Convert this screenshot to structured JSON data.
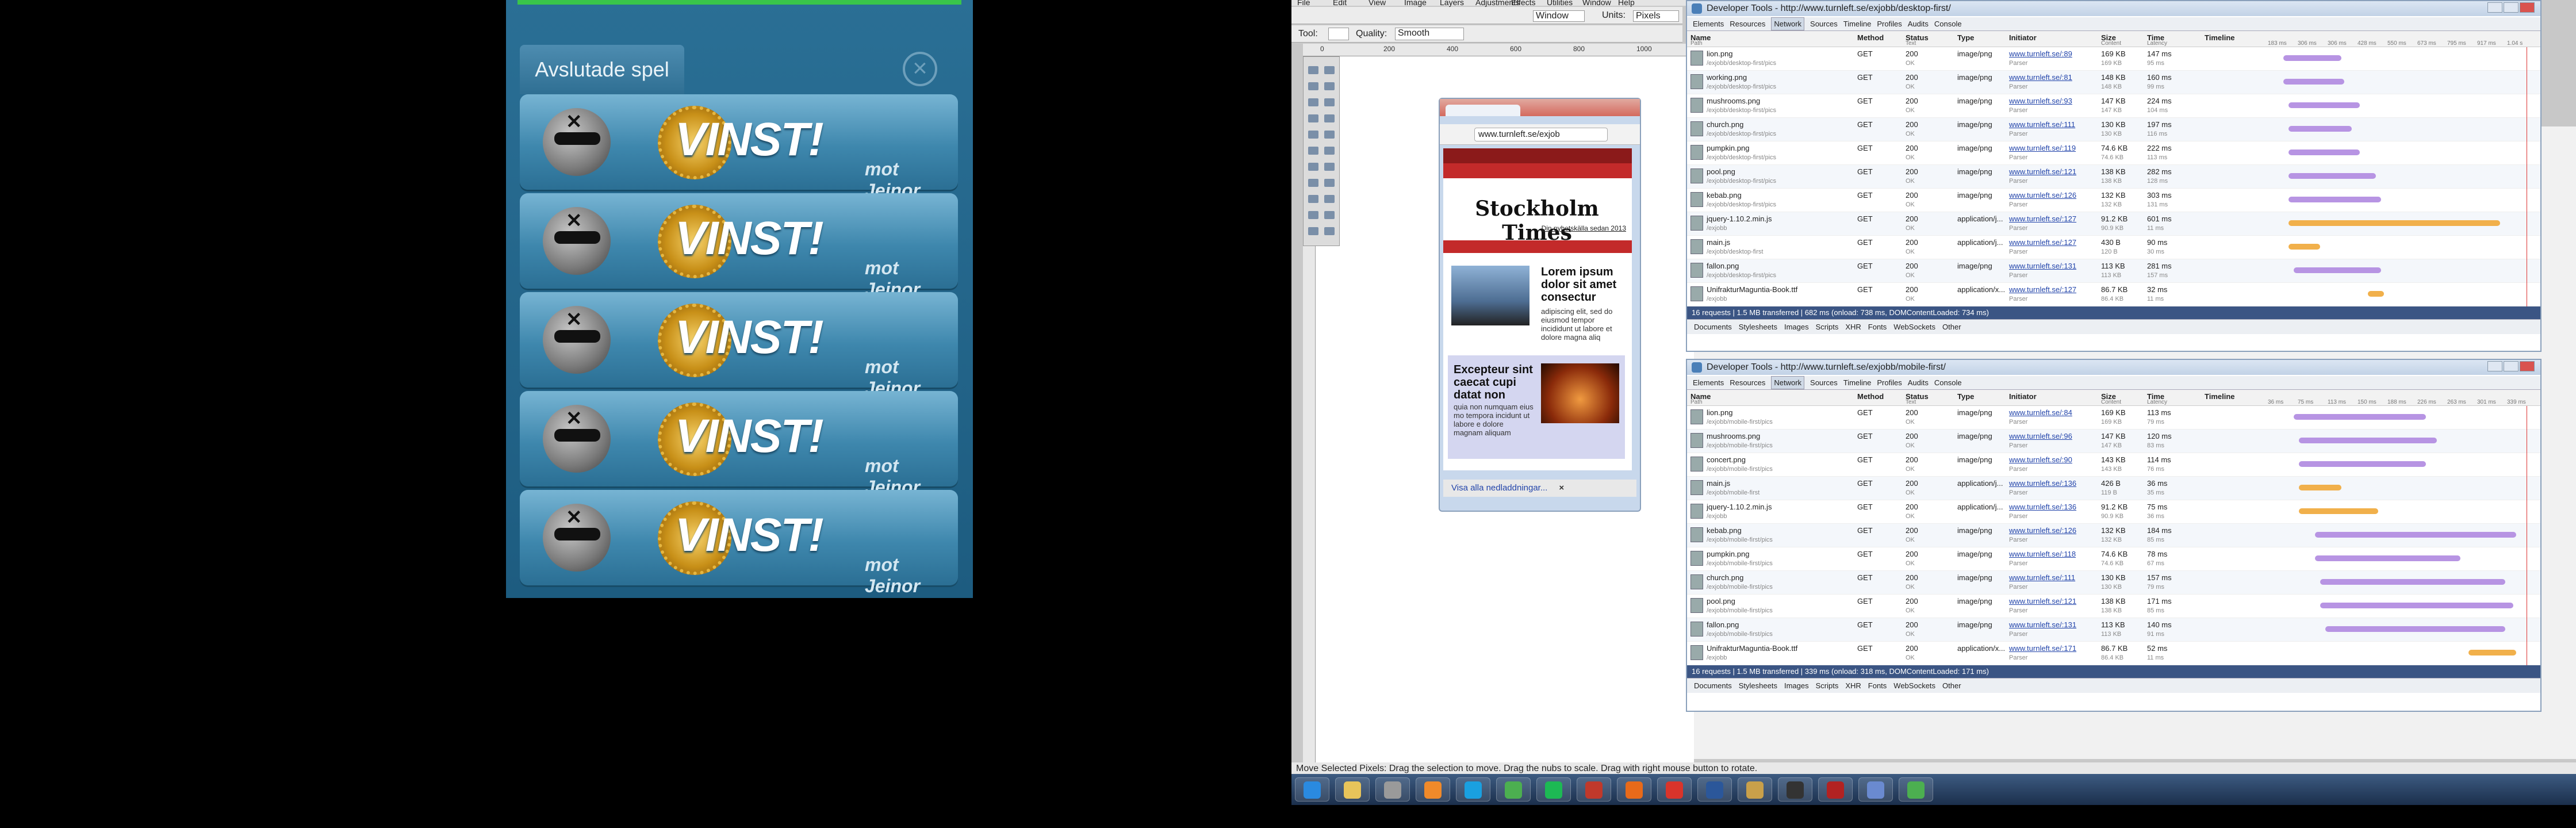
{
  "game": {
    "header": "Avslutade spel",
    "rows": [
      {
        "result": "VINST!",
        "opponent": "mot Jeinor"
      },
      {
        "result": "VINST!",
        "opponent": "mot Jeinor"
      },
      {
        "result": "VINST!",
        "opponent": "mot Jeinor"
      },
      {
        "result": "VINST!",
        "opponent": "mot Jeinor"
      },
      {
        "result": "VINST!",
        "opponent": "mot Jeinor"
      }
    ]
  },
  "photoshop": {
    "menu": [
      "File",
      "Edit",
      "View",
      "Image",
      "Layers",
      "Adjustments",
      "Effects",
      "Utilities",
      "Window",
      "Help"
    ],
    "window_dropdown": "Window",
    "units_label": "Units:",
    "units_value": "Pixels",
    "tool_label": "Tool:",
    "quality_label": "Quality:",
    "quality_value": "Smooth",
    "ruler_ticks": [
      "0",
      "200",
      "400",
      "600",
      "800",
      "1000"
    ],
    "status_text": "Move Selected Pixels: Drag the selection to move. Drag the nubs to scale. Drag with right mouse button to rotate."
  },
  "browser": {
    "url": "www.turnleft.se/exjob",
    "masthead": "Stockholm Times",
    "tagline": "Din nyhetskälla sedan 2013",
    "headline1": "Lorem ipsum dolor sit amet consectur",
    "body1": "adipiscing elit, sed do eiusmod tempor incididunt ut labore et dolore magna aliq",
    "headline2": "Excepteur sint caecat cupi datat non",
    "body2": "quia non numquam eius mo tempora incidunt ut labore e dolore magnam aliquam",
    "downloads_link": "Visa alla nedladdningar..."
  },
  "devtools": [
    {
      "title": "Developer Tools - http://www.turnleft.se/exjobb/desktop-first/",
      "tabs": [
        "Elements",
        "Resources",
        "Network",
        "Sources",
        "Timeline",
        "Profiles",
        "Audits",
        "Console"
      ],
      "active_tab": "Network",
      "columns": [
        "Name",
        "Method",
        "Status",
        "Type",
        "Initiator",
        "Size",
        "Time",
        "Timeline"
      ],
      "column_subs": [
        "Path",
        "",
        "Text",
        "",
        "",
        "Content",
        "Latency",
        ""
      ],
      "scale": [
        "183 ms",
        "306 ms",
        "306 ms",
        "428 ms",
        "550 ms",
        "673 ms",
        "795 ms",
        "917 ms",
        "1.04 s"
      ],
      "rows": [
        {
          "name": "lion.png",
          "path": "/exjobb/desktop-first/pics",
          "method": "GET",
          "status": "200",
          "text": "OK",
          "type": "image/png",
          "initiator": "www.turnleft.se/:89",
          "init_sub": "Parser",
          "size": "169 KB",
          "content": "169 KB",
          "time": "147 ms",
          "latency": "95 ms",
          "bar_start": 0.08,
          "bar_width": 0.22,
          "js": false
        },
        {
          "name": "working.png",
          "path": "/exjobb/desktop-first/pics",
          "method": "GET",
          "status": "200",
          "text": "OK",
          "type": "image/png",
          "initiator": "www.turnleft.se/:81",
          "init_sub": "Parser",
          "size": "148 KB",
          "content": "148 KB",
          "time": "160 ms",
          "latency": "99 ms",
          "bar_start": 0.08,
          "bar_width": 0.23,
          "js": false
        },
        {
          "name": "mushrooms.png",
          "path": "/exjobb/desktop-first/pics",
          "method": "GET",
          "status": "200",
          "text": "OK",
          "type": "image/png",
          "initiator": "www.turnleft.se/:93",
          "init_sub": "Parser",
          "size": "147 KB",
          "content": "147 KB",
          "time": "224 ms",
          "latency": "104 ms",
          "bar_start": 0.1,
          "bar_width": 0.27,
          "js": false
        },
        {
          "name": "church.png",
          "path": "/exjobb/desktop-first/pics",
          "method": "GET",
          "status": "200",
          "text": "OK",
          "type": "image/png",
          "initiator": "www.turnleft.se/:111",
          "init_sub": "Parser",
          "size": "130 KB",
          "content": "130 KB",
          "time": "197 ms",
          "latency": "116 ms",
          "bar_start": 0.1,
          "bar_width": 0.24,
          "js": false
        },
        {
          "name": "pumpkin.png",
          "path": "/exjobb/desktop-first/pics",
          "method": "GET",
          "status": "200",
          "text": "OK",
          "type": "image/png",
          "initiator": "www.turnleft.se/:119",
          "init_sub": "Parser",
          "size": "74.6 KB",
          "content": "74.6 KB",
          "time": "222 ms",
          "latency": "113 ms",
          "bar_start": 0.1,
          "bar_width": 0.27,
          "js": false
        },
        {
          "name": "pool.png",
          "path": "/exjobb/desktop-first/pics",
          "method": "GET",
          "status": "200",
          "text": "OK",
          "type": "image/png",
          "initiator": "www.turnleft.se/:121",
          "init_sub": "Parser",
          "size": "138 KB",
          "content": "138 KB",
          "time": "282 ms",
          "latency": "128 ms",
          "bar_start": 0.1,
          "bar_width": 0.33,
          "js": false
        },
        {
          "name": "kebab.png",
          "path": "/exjobb/desktop-first/pics",
          "method": "GET",
          "status": "200",
          "text": "OK",
          "type": "image/png",
          "initiator": "www.turnleft.se/:126",
          "init_sub": "Parser",
          "size": "132 KB",
          "content": "132 KB",
          "time": "303 ms",
          "latency": "131 ms",
          "bar_start": 0.1,
          "bar_width": 0.35,
          "js": false
        },
        {
          "name": "jquery-1.10.2.min.js",
          "path": "/exjobb",
          "method": "GET",
          "status": "200",
          "text": "OK",
          "type": "application/j...",
          "initiator": "www.turnleft.se/:127",
          "init_sub": "Parser",
          "size": "91.2 KB",
          "content": "90.9 KB",
          "time": "601 ms",
          "latency": "11 ms",
          "bar_start": 0.1,
          "bar_width": 0.8,
          "js": true
        },
        {
          "name": "main.js",
          "path": "/exjobb/desktop-first",
          "method": "GET",
          "status": "200",
          "text": "OK",
          "type": "application/j...",
          "initiator": "www.turnleft.se/:127",
          "init_sub": "Parser",
          "size": "430 B",
          "content": "120 B",
          "time": "90 ms",
          "latency": "30 ms",
          "bar_start": 0.1,
          "bar_width": 0.12,
          "js": true
        },
        {
          "name": "fallon.png",
          "path": "/exjobb/desktop-first/pics",
          "method": "GET",
          "status": "200",
          "text": "OK",
          "type": "image/png",
          "initiator": "www.turnleft.se/:131",
          "init_sub": "Parser",
          "size": "113 KB",
          "content": "113 KB",
          "time": "281 ms",
          "latency": "157 ms",
          "bar_start": 0.12,
          "bar_width": 0.33,
          "js": false
        },
        {
          "name": "UnifrakturMaguntia-Book.ttf",
          "path": "/exjobb",
          "method": "GET",
          "status": "200",
          "text": "OK",
          "type": "application/x...",
          "initiator": "www.turnleft.se/:127",
          "init_sub": "Parser",
          "size": "86.7 KB",
          "content": "86.4 KB",
          "time": "32 ms",
          "latency": "11 ms",
          "bar_start": 0.4,
          "bar_width": 0.06,
          "js": true
        }
      ],
      "summary": "16 requests  |  1.5 MB transferred  |  682 ms (onload: 738 ms, DOMContentLoaded: 734 ms)",
      "filters": [
        "Documents",
        "Stylesheets",
        "Images",
        "Scripts",
        "XHR",
        "Fonts",
        "WebSockets",
        "Other"
      ]
    },
    {
      "title": "Developer Tools - http://www.turnleft.se/exjobb/mobile-first/",
      "tabs": [
        "Elements",
        "Resources",
        "Network",
        "Sources",
        "Timeline",
        "Profiles",
        "Audits",
        "Console"
      ],
      "active_tab": "Network",
      "columns": [
        "Name",
        "Method",
        "Status",
        "Type",
        "Initiator",
        "Size",
        "Time",
        "Timeline"
      ],
      "column_subs": [
        "Path",
        "",
        "Text",
        "",
        "",
        "Content",
        "Latency",
        ""
      ],
      "scale": [
        "36 ms",
        "75 ms",
        "113 ms",
        "150 ms",
        "188 ms",
        "226 ms",
        "263 ms",
        "301 ms",
        "339 ms"
      ],
      "rows": [
        {
          "name": "lion.png",
          "path": "/exjobb/mobile-first/pics",
          "method": "GET",
          "status": "200",
          "text": "OK",
          "type": "image/png",
          "initiator": "www.turnleft.se/:84",
          "init_sub": "Parser",
          "size": "169 KB",
          "content": "169 KB",
          "time": "113 ms",
          "latency": "79 ms",
          "bar_start": 0.12,
          "bar_width": 0.5,
          "js": false
        },
        {
          "name": "mushrooms.png",
          "path": "/exjobb/mobile-first/pics",
          "method": "GET",
          "status": "200",
          "text": "OK",
          "type": "image/png",
          "initiator": "www.turnleft.se/:96",
          "init_sub": "Parser",
          "size": "147 KB",
          "content": "147 KB",
          "time": "120 ms",
          "latency": "83 ms",
          "bar_start": 0.14,
          "bar_width": 0.52,
          "js": false
        },
        {
          "name": "concert.png",
          "path": "/exjobb/mobile-first/pics",
          "method": "GET",
          "status": "200",
          "text": "OK",
          "type": "image/png",
          "initiator": "www.turnleft.se/:90",
          "init_sub": "Parser",
          "size": "143 KB",
          "content": "143 KB",
          "time": "114 ms",
          "latency": "76 ms",
          "bar_start": 0.14,
          "bar_width": 0.48,
          "js": false
        },
        {
          "name": "main.js",
          "path": "/exjobb/mobile-first",
          "method": "GET",
          "status": "200",
          "text": "OK",
          "type": "application/j...",
          "initiator": "www.turnleft.se/:136",
          "init_sub": "Parser",
          "size": "426 B",
          "content": "119 B",
          "time": "36 ms",
          "latency": "35 ms",
          "bar_start": 0.14,
          "bar_width": 0.16,
          "js": true
        },
        {
          "name": "jquery-1.10.2.min.js",
          "path": "/exjobb",
          "method": "GET",
          "status": "200",
          "text": "OK",
          "type": "application/j...",
          "initiator": "www.turnleft.se/:136",
          "init_sub": "Parser",
          "size": "91.2 KB",
          "content": "90.9 KB",
          "time": "75 ms",
          "latency": "36 ms",
          "bar_start": 0.14,
          "bar_width": 0.3,
          "js": true
        },
        {
          "name": "kebab.png",
          "path": "/exjobb/mobile-first/pics",
          "method": "GET",
          "status": "200",
          "text": "OK",
          "type": "image/png",
          "initiator": "www.turnleft.se/:126",
          "init_sub": "Parser",
          "size": "132 KB",
          "content": "132 KB",
          "time": "184 ms",
          "latency": "85 ms",
          "bar_start": 0.2,
          "bar_width": 0.76,
          "js": false
        },
        {
          "name": "pumpkin.png",
          "path": "/exjobb/mobile-first/pics",
          "method": "GET",
          "status": "200",
          "text": "OK",
          "type": "image/png",
          "initiator": "www.turnleft.se/:118",
          "init_sub": "Parser",
          "size": "74.6 KB",
          "content": "74.6 KB",
          "time": "78 ms",
          "latency": "67 ms",
          "bar_start": 0.2,
          "bar_width": 0.55,
          "js": false
        },
        {
          "name": "church.png",
          "path": "/exjobb/mobile-first/pics",
          "method": "GET",
          "status": "200",
          "text": "OK",
          "type": "image/png",
          "initiator": "www.turnleft.se/:111",
          "init_sub": "Parser",
          "size": "130 KB",
          "content": "130 KB",
          "time": "157 ms",
          "latency": "79 ms",
          "bar_start": 0.22,
          "bar_width": 0.7,
          "js": false
        },
        {
          "name": "pool.png",
          "path": "/exjobb/mobile-first/pics",
          "method": "GET",
          "status": "200",
          "text": "OK",
          "type": "image/png",
          "initiator": "www.turnleft.se/:121",
          "init_sub": "Parser",
          "size": "138 KB",
          "content": "138 KB",
          "time": "171 ms",
          "latency": "85 ms",
          "bar_start": 0.22,
          "bar_width": 0.73,
          "js": false
        },
        {
          "name": "fallon.png",
          "path": "/exjobb/mobile-first/pics",
          "method": "GET",
          "status": "200",
          "text": "OK",
          "type": "image/png",
          "initiator": "www.turnleft.se/:131",
          "init_sub": "Parser",
          "size": "113 KB",
          "content": "113 KB",
          "time": "140 ms",
          "latency": "91 ms",
          "bar_start": 0.24,
          "bar_width": 0.68,
          "js": false
        },
        {
          "name": "UnifrakturMaguntia-Book.ttf",
          "path": "/exjobb",
          "method": "GET",
          "status": "200",
          "text": "OK",
          "type": "application/x...",
          "initiator": "www.turnleft.se/:171",
          "init_sub": "Parser",
          "size": "86.7 KB",
          "content": "86.4 KB",
          "time": "52 ms",
          "latency": "11 ms",
          "bar_start": 0.78,
          "bar_width": 0.18,
          "js": true
        }
      ],
      "summary": "16 requests  |  1.5 MB transferred  |  339 ms (onload: 318 ms, DOMContentLoaded: 171 ms)",
      "filters": [
        "Documents",
        "Stylesheets",
        "Images",
        "Scripts",
        "XHR",
        "Fonts",
        "WebSockets",
        "Other"
      ]
    }
  ],
  "taskbar": {
    "apps": [
      "start-orb",
      "explorer",
      "media-player",
      "outlook",
      "skype",
      "chrome",
      "spotify",
      "filezilla-red",
      "firefox",
      "pdf-reader",
      "word",
      "archive",
      "terminal",
      "filezilla",
      "paint",
      "chrome"
    ],
    "colors": [
      "#2a8ae0",
      "#e8c45a",
      "#9a9a9a",
      "#f08a2a",
      "#1aa0e0",
      "#4caf50",
      "#1db954",
      "#c0392b",
      "#e86a1a",
      "#d9342b",
      "#2b579a",
      "#c9a04a",
      "#333333",
      "#b22222",
      "#6a8ad0",
      "#4caf50"
    ]
  }
}
